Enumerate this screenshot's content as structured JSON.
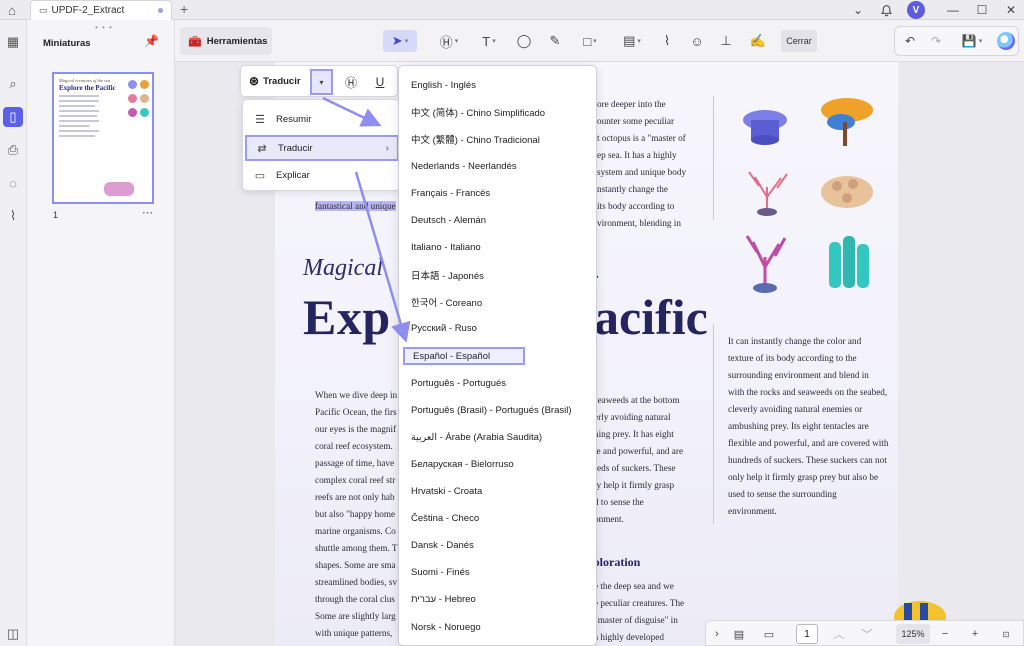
{
  "tabbar": {
    "tab_title": "UPDF-2_Extract",
    "avatar_letter": "V"
  },
  "thumbnails": {
    "title": "Miniaturas",
    "page_number": "1",
    "thumb_subtitle": "Magical creatures of the sea",
    "thumb_title": "Explore the Pacific"
  },
  "toolbar": {
    "herramientas_label": "Herramientas",
    "close_label": "Cerrar"
  },
  "translate_bar": {
    "label": "Traducir"
  },
  "submenu": {
    "items": [
      {
        "label": "Resumir"
      },
      {
        "label": "Traducir"
      },
      {
        "label": "Explicar"
      }
    ]
  },
  "languages": [
    "English - Inglés",
    "中文 (简体) - Chino Simplificado",
    "中文 (繁體) - Chino Tradicional",
    "Nederlands - Neerlandés",
    "Français - Francés",
    "Deutsch - Alemán",
    "Italiano - Italiano",
    "日本語 - Japonés",
    "한국어 - Coreano",
    "Русский - Ruso",
    "Español - Español",
    "Português - Portugués",
    "Português (Brasil) - Portugués (Brasil)",
    "العربية - Árabe (Arabia Saudita)",
    "Беларуская - Bielorruso",
    "Hrvatski - Croata",
    "Čeština - Checo",
    "Dansk - Danés",
    "Suomi - Finés",
    "עברית - Hebreo",
    "Norsk - Noruego"
  ],
  "selected_language": "Español - Español",
  "document": {
    "highlight_text": "fantastical and unique",
    "magical_start": "Magical",
    "magical_end": "a.",
    "big_start": "Exp",
    "big_end": "acific",
    "exploration": "ploration",
    "mid_top_lines": [
      "ore deeper into the",
      "ounter some peculiar",
      "t octopus is a \"master of",
      "ep sea. It has a highly",
      " system and unique body",
      "nstantly change the",
      "its body according to",
      "vironment, blending in"
    ],
    "left_lines": [
      "When we dive deep in",
      "Pacific Ocean, the firs",
      "our eyes is the magnif",
      "coral reef ecosystem.",
      "passage of time, have",
      "complex coral reef str",
      "reefs are not only hab",
      "but also \"happy home",
      "marine organisms. Co",
      "shuttle among them. T",
      "shapes. Some are sma",
      "streamlined bodies, sv",
      "through the coral clus",
      "Some are slightly larg",
      "with unique patterns,"
    ],
    "mid_lines": [
      " seaweeds at the bottom",
      "erly avoiding natural",
      "hing prey. It has eight",
      "le and powerful, and are",
      "reds of suckers. These",
      "ly help it firmly grasp",
      "d to sense the",
      "onment."
    ],
    "mid_bottom_lines": [
      "e the deep sea and we",
      "e peculiar creatures. The",
      "\"master of disguise\" in",
      "a highly developed"
    ],
    "right_lines": [
      "It can instantly change the color and",
      "texture of its body according to the",
      "surrounding environment and blend in",
      "with the rocks and seaweeds on the seabed,",
      "cleverly avoiding natural enemies or",
      "ambushing prey. Its eight tentacles are",
      "flexible and powerful, and are covered with",
      "hundreds of suckers. These suckers can not",
      "only help it firmly grasp prey but also be",
      "used to sense the surrounding",
      "environment."
    ]
  },
  "status": {
    "page": "1",
    "zoom": "125%"
  }
}
